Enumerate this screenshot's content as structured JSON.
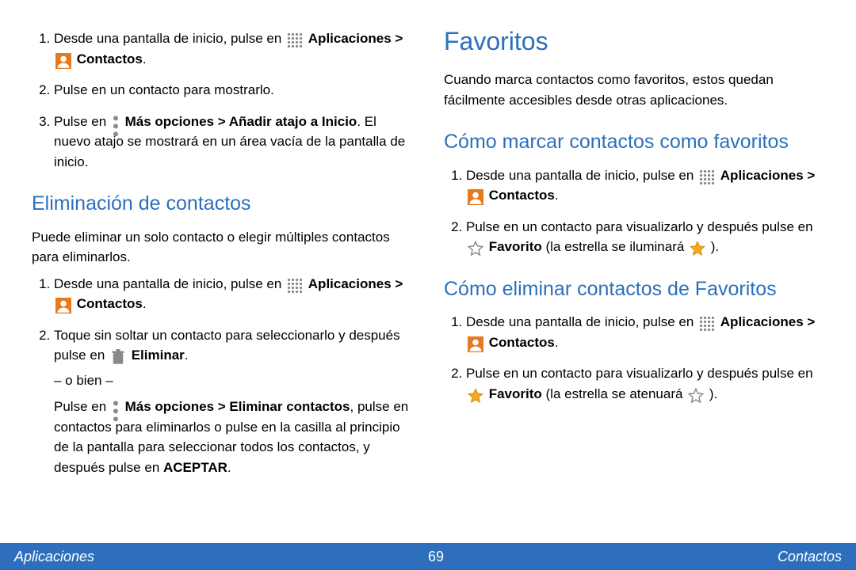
{
  "left": {
    "list1": [
      {
        "before": "Desde una pantalla de inicio, pulse en ",
        "bold1": "Aplicaciones > ",
        "bold2": " Contactos",
        "after": "."
      },
      {
        "text": "Pulse en un contacto para mostrarlo."
      },
      {
        "before": "Pulse en ",
        "bold1": " Más opciones > Añadir atajo a Inicio",
        "after": ". El nuevo atajo se mostrará en un área vacía de la pantalla de inicio."
      }
    ],
    "h2": "Eliminación de contactos",
    "p_elim": "Puede eliminar un solo contacto o elegir múltiples contactos para eliminarlos.",
    "list2": [
      {
        "before": "Desde una pantalla de inicio, pulse en ",
        "bold1": "Aplicaciones > ",
        "bold2": " Contactos",
        "after": "."
      },
      {
        "before": "Toque sin soltar un contacto para seleccionarlo y después pulse en ",
        "bold1": " Eliminar",
        "after": "."
      }
    ],
    "or": "– o bien –",
    "p2a": "Pulse en ",
    "p2bold": " Más opciones > Eliminar contactos",
    "p2b": ", pulse en contactos para eliminarlos o pulse en la casilla al principio de la pantalla para seleccionar todos los contactos, y después pulse en ",
    "p2bold2": "ACEPTAR",
    "p2c": "."
  },
  "right": {
    "h1": "Favoritos",
    "p_intro": "Cuando marca contactos como favoritos, estos quedan fácilmente accesibles desde otras aplicaciones.",
    "h2a": "Cómo marcar contactos como favoritos",
    "list_a": [
      {
        "before": "Desde una pantalla de inicio, pulse en ",
        "bold1": "Aplicaciones > ",
        "bold2": " Contactos",
        "after": "."
      },
      {
        "before": "Pulse en un contacto para visualizarlo y después pulse en ",
        "bold1": " Favorito",
        "after": " (la estrella se iluminará ",
        "tail": " )."
      }
    ],
    "h2b": "Cómo eliminar contactos de Favoritos",
    "list_b": [
      {
        "before": "Desde una pantalla de inicio, pulse en ",
        "bold1": "Aplicaciones > ",
        "bold2": " Contactos",
        "after": "."
      },
      {
        "before": "Pulse en un contacto para visualizarlo y después pulse en ",
        "bold1": " Favorito",
        "after": " (la estrella se atenuará ",
        "tail": " )."
      }
    ]
  },
  "footer": {
    "left": "Aplicaciones",
    "page": "69",
    "right": "Contactos"
  }
}
